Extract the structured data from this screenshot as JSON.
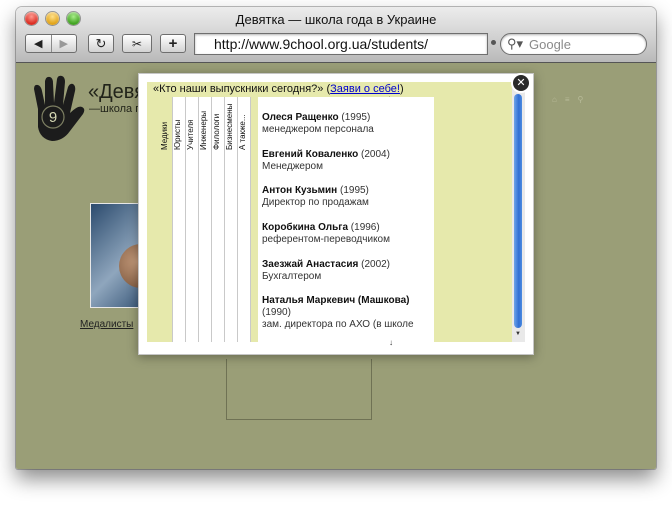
{
  "window": {
    "title": "Девятка — школа года в Украине"
  },
  "toolbar": {
    "back_icon": "◀",
    "forward_icon": "▶",
    "reload_icon": "↻",
    "snip_icon": "✂",
    "plus_icon": "+"
  },
  "address": {
    "url": "http://www.9chool.org.ua/students/"
  },
  "search": {
    "placeholder": "Google",
    "icon": "magnifier-icon"
  },
  "page": {
    "site_title": "«Девя",
    "site_subtitle": "—школа го",
    "logo_digit": "9",
    "thumb_caption": "Медалисты"
  },
  "popup": {
    "close_icon": "✕",
    "heading": "«Кто наши выпускники сегодня?»",
    "paren_open": " (",
    "link_label": "Заяви о себе!",
    "paren_close": ")",
    "up_arrow": "↑",
    "down_tick": "↓",
    "tabs": [
      "Медики",
      "Юристы",
      "Учителя",
      "Инженеры",
      "Филологи",
      "Бизнесмены",
      "А также..."
    ],
    "people": [
      {
        "name": "Олеся Ращенко",
        "year": "(1995)",
        "position": "менеджером персонала"
      },
      {
        "name": "Евгений Коваленко",
        "year": "(2004)",
        "position": "Менеджером"
      },
      {
        "name": "Антон Кузьмин",
        "year": "(1995)",
        "position": "Директор по продажам"
      },
      {
        "name": "Коробкина Ольга",
        "year": "(1996)",
        "position": "референтом-переводчиком"
      },
      {
        "name": "Заезжай Анастасия",
        "year": "(2002)",
        "position": "Бухгалтером"
      },
      {
        "name": "Наталья Маркевич (Машкова)",
        "year": "(1990)",
        "position": "зам. директора по АХО (в школе"
      }
    ]
  },
  "colors": {
    "page_bg": "#9a9e77",
    "panel_bg": "#e6e9ac",
    "scroll_thumb": "#2f6fd4",
    "link": "#0000cc"
  }
}
